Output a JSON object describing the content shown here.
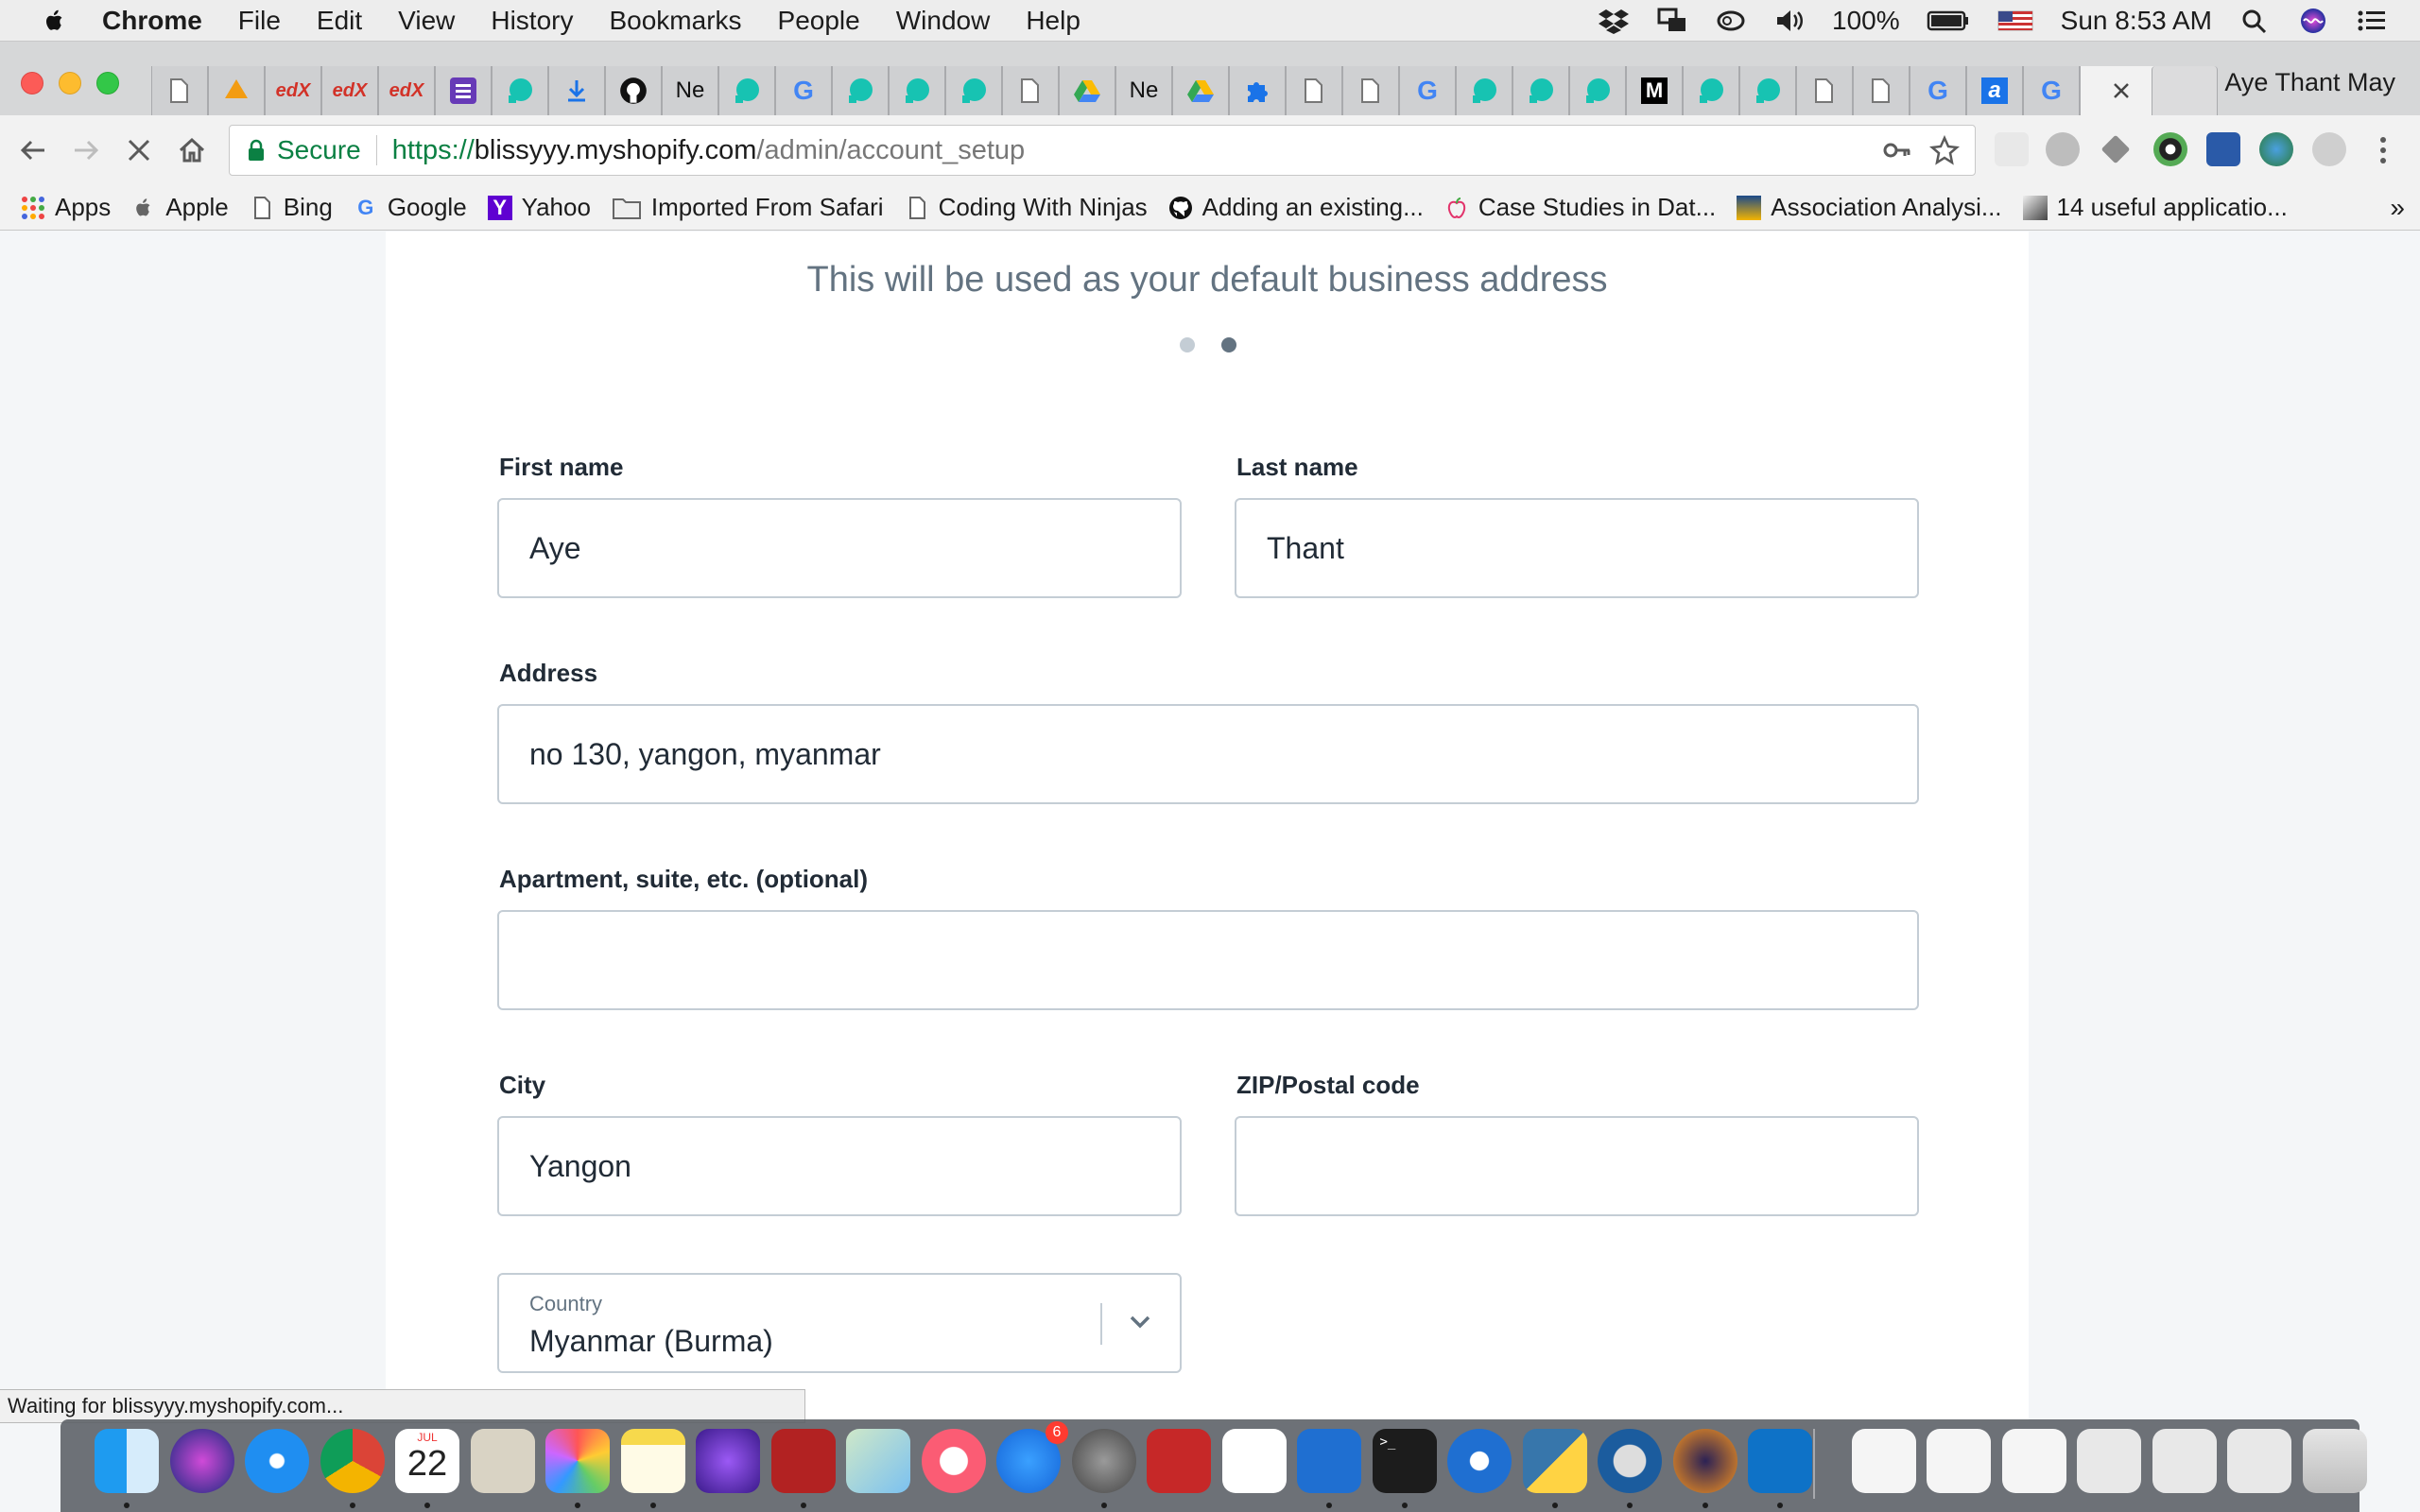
{
  "menubar": {
    "app": "Chrome",
    "items": [
      "File",
      "Edit",
      "View",
      "History",
      "Bookmarks",
      "People",
      "Window",
      "Help"
    ],
    "battery": "100%",
    "clock": "Sun 8:53 AM"
  },
  "browser": {
    "profile_name": "Aye Thant May",
    "secure_label": "Secure",
    "url_scheme": "https://",
    "url_host": "blissyyy.myshopify.com",
    "url_path": "/admin/account_setup",
    "tab_favicons": [
      "document-icon",
      "pma-icon",
      "edx-icon",
      "edx-icon",
      "edx-icon",
      "list-icon",
      "shopify-icon",
      "download-icon",
      "github-icon",
      "ne-icon",
      "shopify-icon",
      "google-icon",
      "shopify-icon",
      "shopify-icon",
      "shopify-icon",
      "document-icon",
      "drive-icon",
      "ne-icon",
      "drive-icon",
      "puzzle-icon",
      "document-icon",
      "document-icon",
      "google-icon",
      "shopify-icon",
      "shopify-icon",
      "shopify-icon",
      "medium-icon",
      "shopify-icon",
      "shopify-icon",
      "document-icon",
      "document-icon",
      "google-icon",
      "a-icon",
      "google-icon",
      "close-icon"
    ],
    "tab_texts": {
      "ne": "Ne",
      "edx": "edX",
      "m": "M",
      "a": "a"
    },
    "status_text": "Waiting for blissyyy.myshopify.com...",
    "bookmarks": [
      {
        "label": "Apps",
        "icon": "apps-grid-icon"
      },
      {
        "label": "Apple",
        "icon": "apple-icon"
      },
      {
        "label": "Bing",
        "icon": "document-icon"
      },
      {
        "label": "Google",
        "icon": "google-icon"
      },
      {
        "label": "Yahoo",
        "icon": "yahoo-icon"
      },
      {
        "label": "Imported From Safari",
        "icon": "folder-icon"
      },
      {
        "label": "Coding With Ninjas",
        "icon": "document-icon"
      },
      {
        "label": "Adding an existing...",
        "icon": "github-icon"
      },
      {
        "label": "Case Studies in Dat...",
        "icon": "apple-outline-icon"
      },
      {
        "label": "Association Analysi...",
        "icon": "image-icon"
      },
      {
        "label": "14 useful applicatio...",
        "icon": "image-icon"
      }
    ],
    "bookmark_glyphs": {
      "google": "G",
      "yahoo": "Y"
    },
    "more_bookmarks": "»"
  },
  "page": {
    "subtitle": "This will be used as your default business address",
    "step_count": 2,
    "active_step": 2,
    "fields": {
      "first_name": {
        "label": "First name",
        "value": "Aye"
      },
      "last_name": {
        "label": "Last name",
        "value": "Thant"
      },
      "address": {
        "label": "Address",
        "value": "no 130, yangon, myanmar"
      },
      "apartment": {
        "label": "Apartment, suite, etc. (optional)",
        "value": ""
      },
      "city": {
        "label": "City",
        "value": "Yangon"
      },
      "zip": {
        "label": "ZIP/Postal code",
        "value": ""
      },
      "country": {
        "label": "Country",
        "value": "Myanmar (Burma)"
      }
    }
  },
  "dock": {
    "apps": [
      "finder-icon",
      "siri-icon",
      "safari-icon",
      "chrome-icon",
      "calendar-icon",
      "calculator-icon",
      "photos-icon",
      "notes-icon",
      "imovie-icon",
      "photo-booth-icon",
      "maps-icon",
      "itunes-icon",
      "app-store-icon",
      "system-preferences-icon",
      "filezilla-icon",
      "numbers-icon",
      "migration-icon",
      "terminal-icon",
      "sourcetree-icon",
      "python-icon",
      "quicktime-icon",
      "eclipse-icon",
      "vscode-icon",
      "document-thumb-icon",
      "document-thumb-icon",
      "document-thumb-icon",
      "window-thumb-icon",
      "window-thumb-icon",
      "window-thumb-icon",
      "trash-icon"
    ],
    "calendar_month": "JUL",
    "calendar_day": "22",
    "app_store_badge": "6"
  },
  "colors": {
    "secure_green": "#0b8043",
    "label_dark": "#212b36",
    "input_border": "#c4cdd5",
    "subtitle_gray": "#637381",
    "dot_active": "#637381",
    "dot_inactive": "#c4cdd5"
  }
}
